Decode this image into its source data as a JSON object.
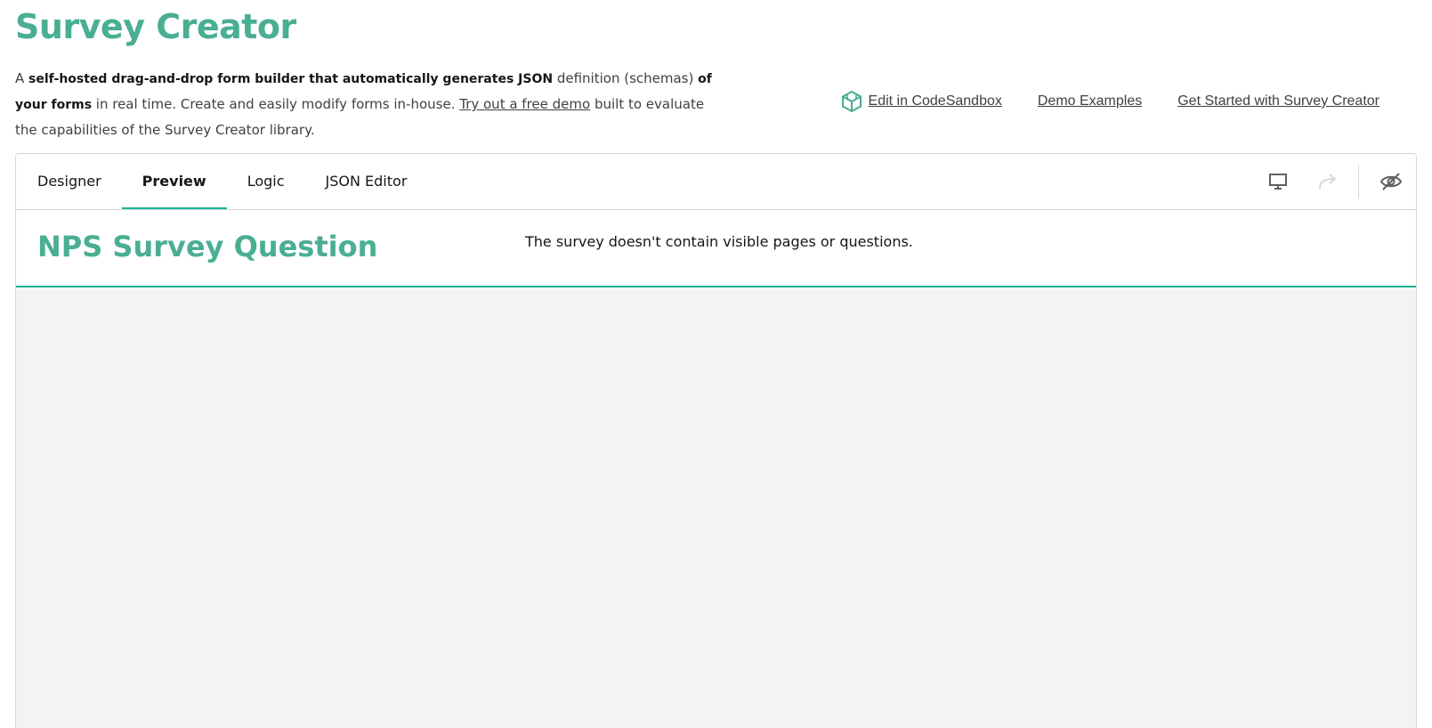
{
  "page": {
    "title": "Survey Creator",
    "intro": {
      "p1": "A ",
      "b1": "self-hosted drag-and-drop form builder that automatically generates JSON",
      "p2": " definition (schemas) ",
      "b2": "of your forms",
      "p3": " in real time. Create and easily modify forms in-house. ",
      "demo_link": "Try out a free demo",
      "p4": " built to evaluate the capabilities of the Survey Creator library."
    },
    "links": {
      "codesandbox": "Edit in CodeSandbox",
      "demo_examples": "Demo Examples",
      "get_started": "Get Started with Survey Creator"
    }
  },
  "creator": {
    "tabs": [
      {
        "label": "Designer",
        "active": false
      },
      {
        "label": "Preview",
        "active": true
      },
      {
        "label": "Logic",
        "active": false
      },
      {
        "label": "JSON Editor",
        "active": false
      }
    ],
    "toolbar": {
      "icons": [
        "desktop-icon",
        "redo-icon",
        "hidden-eye-icon"
      ]
    },
    "survey": {
      "title": "NPS Survey Question",
      "empty_message": "The survey doesn't contain visible pages or questions."
    }
  },
  "colors": {
    "accent": "#19b394",
    "title_green": "#4aae93",
    "canvas_bg": "#f3f3f3",
    "border": "#d6d6d6"
  }
}
